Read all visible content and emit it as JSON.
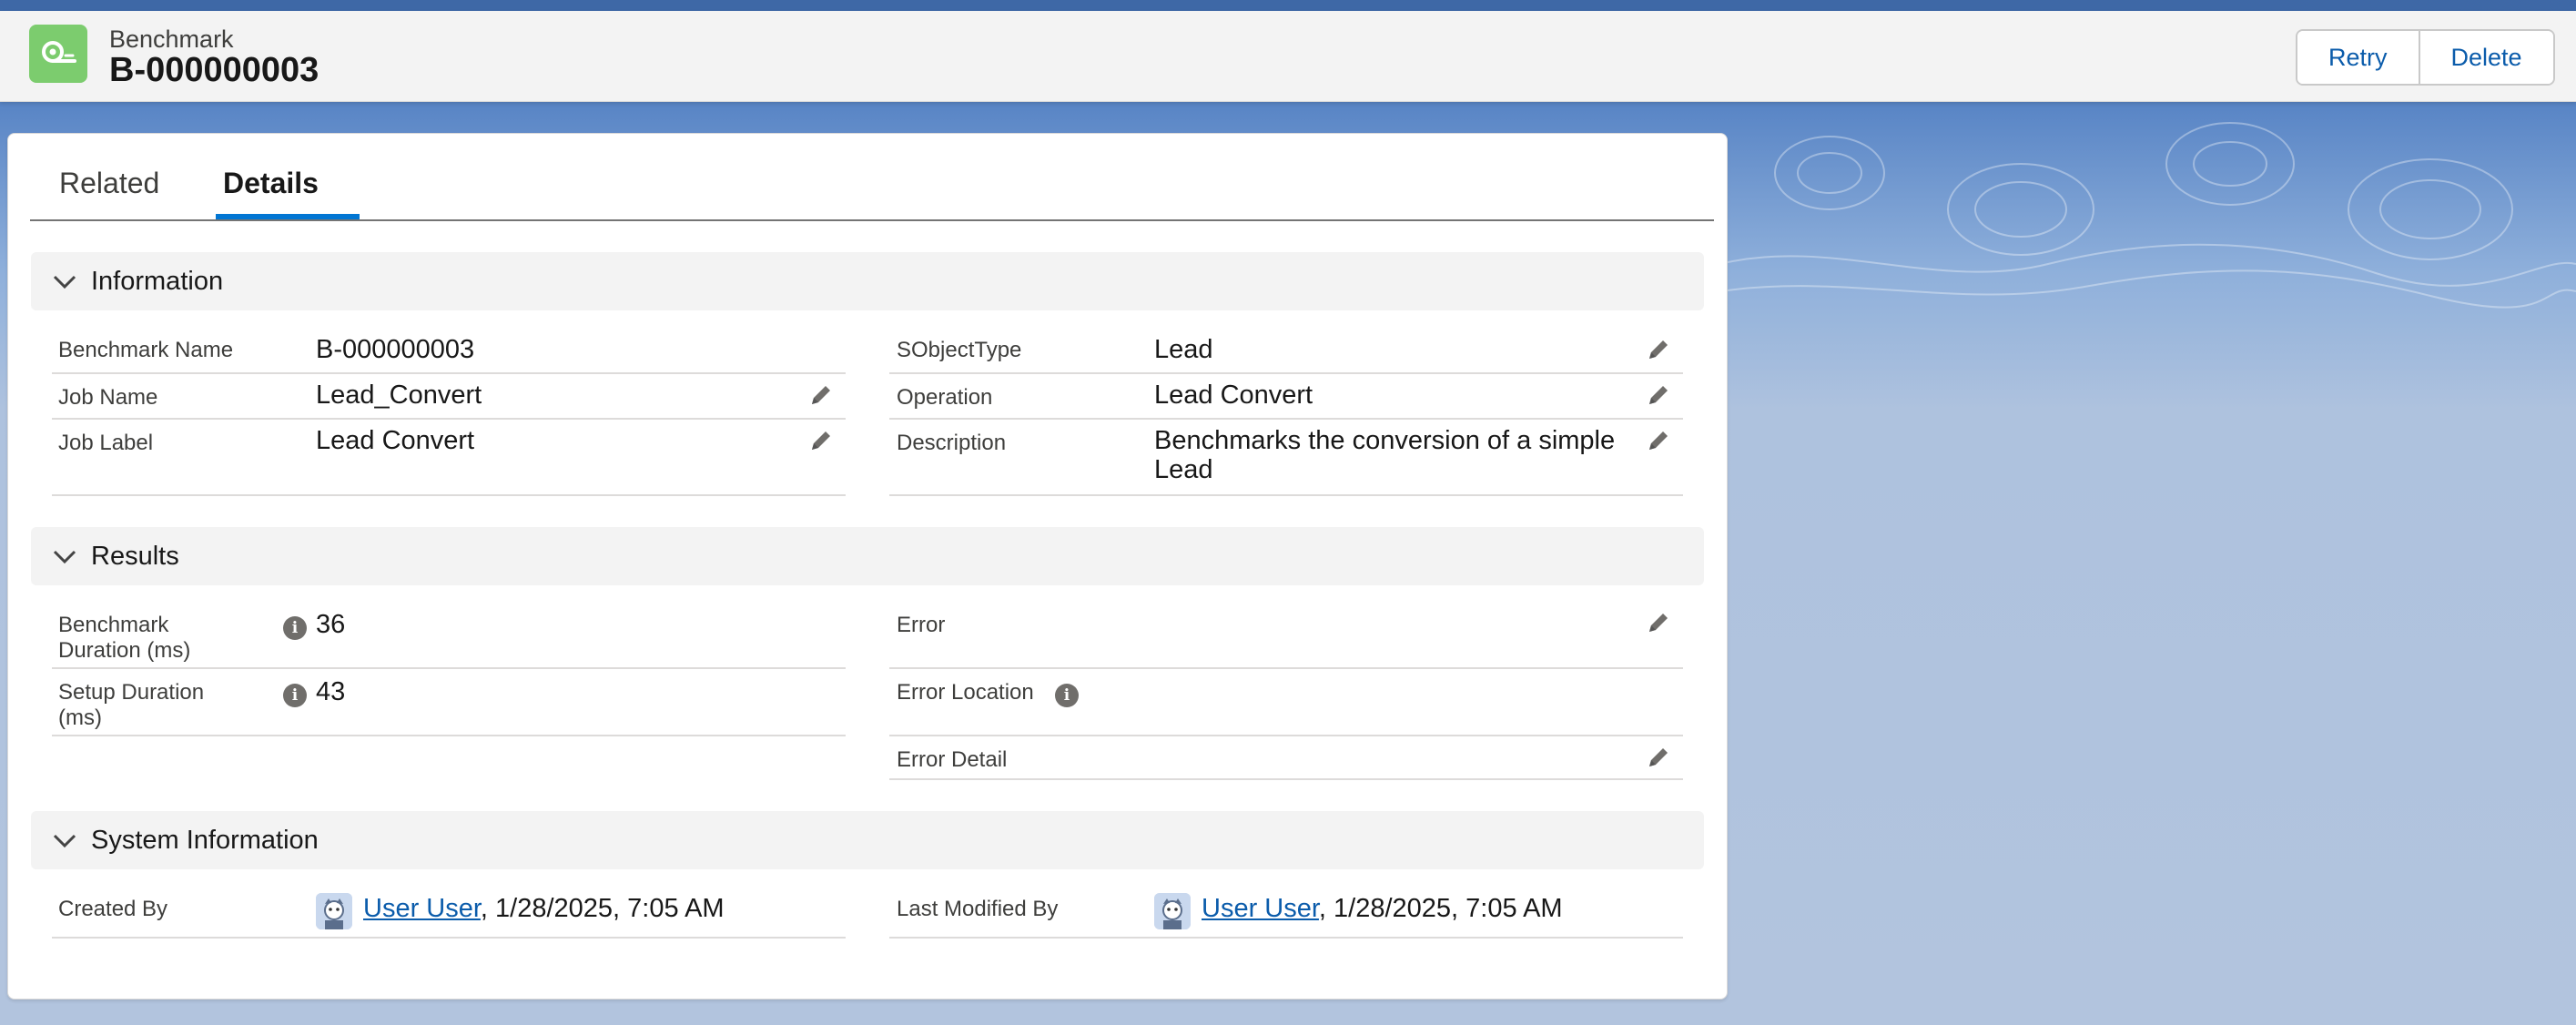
{
  "header": {
    "object_type": "Benchmark",
    "record_name": "B-000000003",
    "icon": "benchmark-icon",
    "actions": {
      "retry": "Retry",
      "delete": "Delete"
    }
  },
  "tabs": [
    {
      "label": "Related",
      "active": false
    },
    {
      "label": "Details",
      "active": true
    }
  ],
  "sections": {
    "information": {
      "title": "Information",
      "fields": {
        "benchmark_name": {
          "label": "Benchmark Name",
          "value": "B-000000003"
        },
        "job_name": {
          "label": "Job Name",
          "value": "Lead_Convert"
        },
        "job_label": {
          "label": "Job Label",
          "value": "Lead Convert"
        },
        "sobject_type": {
          "label": "SObjectType",
          "value": "Lead"
        },
        "operation": {
          "label": "Operation",
          "value": "Lead Convert"
        },
        "description": {
          "label": "Description",
          "value_line1": "Benchmarks the conversion of a simple",
          "value_line2": "Lead"
        }
      }
    },
    "results": {
      "title": "Results",
      "fields": {
        "benchmark_duration": {
          "label_line1": "Benchmark",
          "label_line2": "Duration (ms)",
          "value": "36"
        },
        "setup_duration": {
          "label_line1": "Setup Duration",
          "label_line2": "(ms)",
          "value": "43"
        },
        "error": {
          "label": "Error",
          "value": ""
        },
        "error_location": {
          "label": "Error Location",
          "value": ""
        },
        "error_detail": {
          "label": "Error Detail",
          "value": ""
        }
      }
    },
    "system_information": {
      "title": "System Information",
      "fields": {
        "created_by": {
          "label": "Created By",
          "user": "User User",
          "datetime": ", 1/28/2025, 7:05 AM"
        },
        "last_modified_by": {
          "label": "Last Modified By",
          "user": "User User",
          "datetime": ", 1/28/2025, 7:05 AM"
        }
      }
    }
  },
  "colors": {
    "brand_blue": "#0176d3",
    "link_blue": "#0b5cab",
    "icon_green": "#7ccc6e"
  }
}
